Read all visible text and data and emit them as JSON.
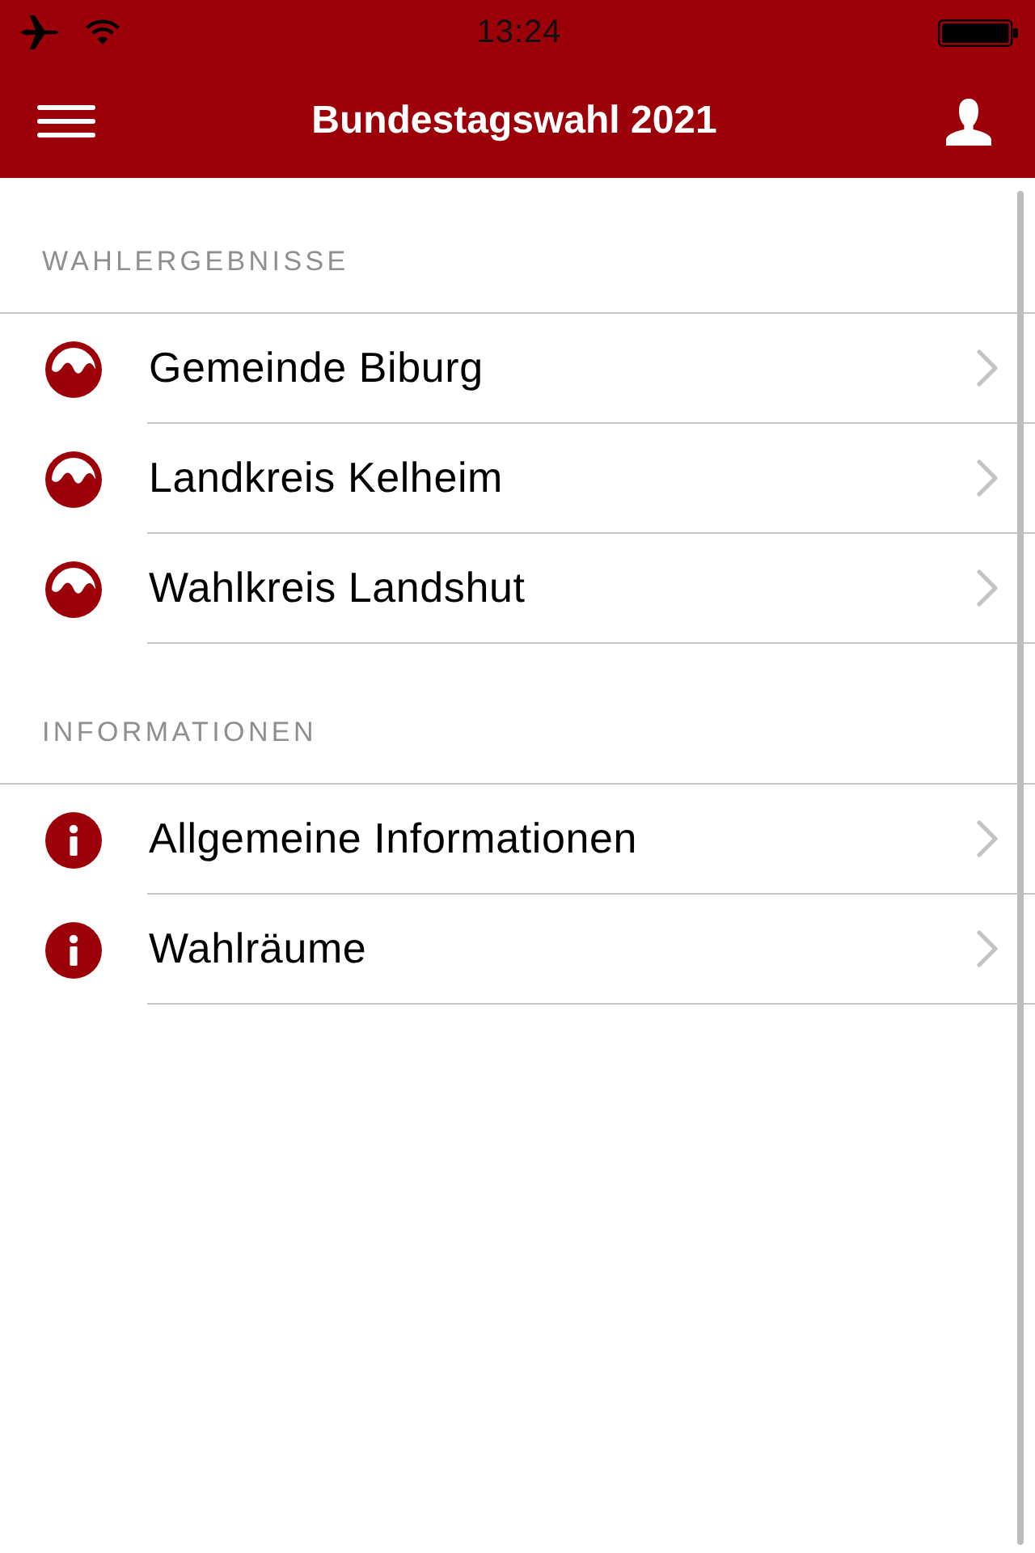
{
  "status_bar": {
    "time": "13:24"
  },
  "nav_bar": {
    "title": "Bundestagswahl 2021"
  },
  "sections": [
    {
      "header": "WAHLERGEBNISSE",
      "items": [
        {
          "kind": "result",
          "label": "Gemeinde Biburg"
        },
        {
          "kind": "result",
          "label": "Landkreis Kelheim"
        },
        {
          "kind": "result",
          "label": "Wahlkreis Landshut"
        }
      ]
    },
    {
      "header": "INFORMATIONEN",
      "items": [
        {
          "kind": "info",
          "label": "Allgemeine Informationen"
        },
        {
          "kind": "info",
          "label": "Wahlräume"
        }
      ]
    }
  ]
}
